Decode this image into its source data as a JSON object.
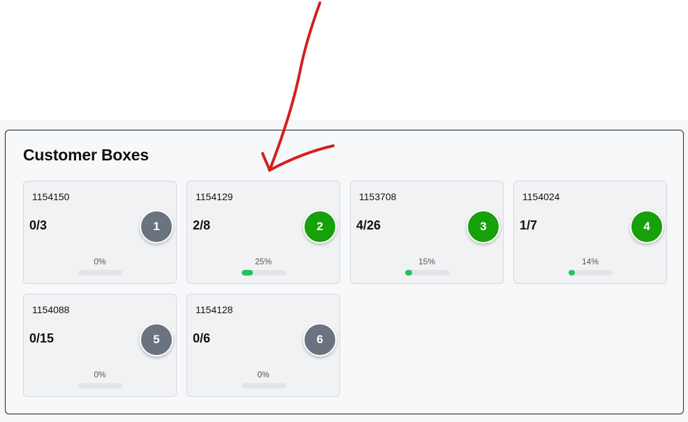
{
  "title": "Customer Boxes",
  "colors": {
    "inactive_badge": "#6b7280",
    "active_badge": "#16a00a",
    "progress_fill": "#22c35e",
    "annotation_arrow": "#d42020"
  },
  "boxes": [
    {
      "id": "1154150",
      "count": "0/3",
      "number": "1",
      "percent": "0%",
      "progress": 0,
      "status": "inactive"
    },
    {
      "id": "1154129",
      "count": "2/8",
      "number": "2",
      "percent": "25%",
      "progress": 0.25,
      "status": "active"
    },
    {
      "id": "1153708",
      "count": "4/26",
      "number": "3",
      "percent": "15%",
      "progress": 0.15,
      "status": "active"
    },
    {
      "id": "1154024",
      "count": "1/7",
      "number": "4",
      "percent": "14%",
      "progress": 0.14,
      "status": "active"
    },
    {
      "id": "1154088",
      "count": "0/15",
      "number": "5",
      "percent": "0%",
      "progress": 0,
      "status": "inactive"
    },
    {
      "id": "1154128",
      "count": "0/6",
      "number": "6",
      "percent": "0%",
      "progress": 0,
      "status": "inactive"
    }
  ]
}
